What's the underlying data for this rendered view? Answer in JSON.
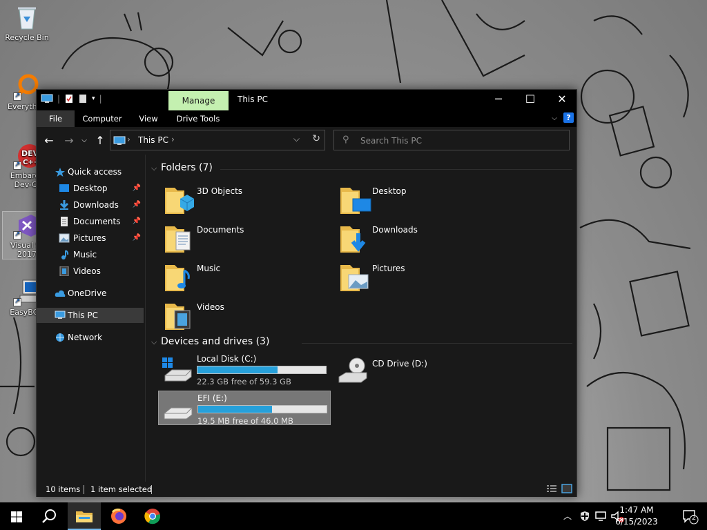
{
  "desktop": {
    "icons": [
      {
        "label": "Recycle Bin"
      },
      {
        "label": "Everyth"
      },
      {
        "label": "Embarca Dev-C-"
      },
      {
        "label": "Visual St 2017"
      },
      {
        "label": "EasyBCD"
      }
    ]
  },
  "window": {
    "title": "This PC",
    "manage_tab": "Manage",
    "ribbon_tabs": [
      "File",
      "Computer",
      "View",
      "Drive Tools"
    ],
    "help": "?",
    "address": {
      "location": "This PC"
    },
    "search": {
      "placeholder": "Search This PC"
    },
    "nav": {
      "quick_access": "Quick access",
      "items": [
        "Desktop",
        "Downloads",
        "Documents",
        "Pictures",
        "Music",
        "Videos"
      ],
      "onedrive": "OneDrive",
      "this_pc": "This PC",
      "network": "Network"
    },
    "folders_header": "Folders (7)",
    "folders": [
      "3D Objects",
      "Desktop",
      "Documents",
      "Downloads",
      "Music",
      "Pictures",
      "Videos"
    ],
    "drives_header": "Devices and drives (3)",
    "drives": [
      {
        "name": "Local Disk (C:)",
        "free": "22.3 GB free of 59.3 GB",
        "used_fraction": 0.624
      },
      {
        "name": "CD Drive (D:)"
      },
      {
        "name": "EFI (E:)",
        "free": "19.5 MB free of 46.0 MB",
        "used_fraction": 0.576
      }
    ],
    "status": {
      "items": "10 items",
      "selected": "1 item selected"
    }
  },
  "taskbar": {
    "time": "1:47 AM",
    "date": "6/15/2023",
    "notifications": "2"
  },
  "colors": {
    "accent": "#26a0da",
    "manage_tab": "#c4f0b0",
    "window_bg": "#191919"
  }
}
